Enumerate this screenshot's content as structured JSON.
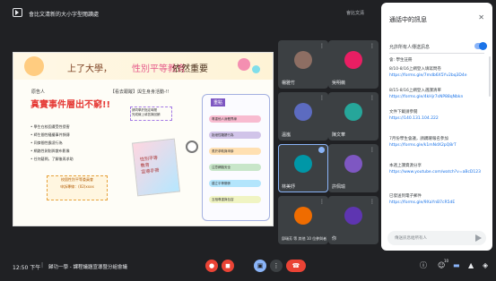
{
  "window": {
    "title": "會比文清新的大小字型閱讀處",
    "badge": "會比文清"
  },
  "slide": {
    "title_a": "上了大學，",
    "title_b": "性別平等教育",
    "title_c": "依然重要",
    "left_small": "原告人",
    "left_big": "真實事件層出不窮!!",
    "left_list": [
      "• 學生在校園遭受性侵害",
      "• 師生間性騷擾事件頻傳",
      "• 同儕間性霸凌行為",
      "• 網路性剝削與散布影像",
      "• 任何疑問，了解後再求助"
    ],
    "left_box": [
      "校園性別平等委員會",
      "申訴專線：(02)xxxx"
    ],
    "mid_head": "【看去跟蹤】與生身身活動-!!",
    "mid_box": [
      "請同學於指定時間",
      "完成線上填答與回饋"
    ],
    "book_text": [
      "性別平等",
      "教育",
      "宣導手冊"
    ],
    "mind_title": "重點",
    "mind_items": [
      "尊重他人身體界線",
      "拒絕性騷擾行為",
      "勇於求助與申訴",
      "注意網路安全",
      "建立平等關係",
      "互相尊重與包容"
    ]
  },
  "participants": [
    {
      "name": "楊雅竹",
      "color": "#8d6e63"
    },
    {
      "name": "吳明薇",
      "color": "#e91e63"
    },
    {
      "name": "溫嵐",
      "color": "#5c6bc0"
    },
    {
      "name": "陳文華",
      "color": "#26a69a"
    },
    {
      "name": "林美妤",
      "color": "#0097a7"
    },
    {
      "name": "許佩瑜",
      "color": "#7e57c2"
    },
    {
      "name": "邱瑞芳 等 其他 10 位參與者",
      "color": "#ef6c00"
    },
    {
      "name": "你",
      "color": "#5e35b1"
    }
  ],
  "chat": {
    "title": "通話中的訊息",
    "close": "✕",
    "setting_label": "允許所有人傳送訊息",
    "messages": [
      {
        "text": "會: 學生註冊",
        "link": ""
      },
      {
        "text": "8/10-8/16上網登入填寫問卷",
        "link": "https://forms.gle/7mdb6X5Yv2bq3D4e"
      },
      {
        "text": "8/15-8/16上網登入選課清單",
        "link": "https://forms.gle/4kHjr7sNP88qNbkn"
      },
      {
        "text": "文件下載請參閱",
        "link": "https://140.131.104.222"
      },
      {
        "text": "7月份學生會議，請踴躍報名參加",
        "link": "https://forms.gle/k1mNdX2pQ8rT"
      },
      {
        "text": "本週上課資源分享",
        "link": "https://www.youtube.com/watch?v=aBcD123"
      },
      {
        "text": "已發送到電子郵件",
        "link": "https://forms.gle/9XaYnB7cR5dE"
      }
    ],
    "input_placeholder": "傳送訊息給所有人"
  },
  "bottom": {
    "time": "12:50 下午",
    "separator": "|",
    "meeting": "歸功一學 - 課程議題宣導暨分組會議",
    "controls": [
      {
        "name": "mic-off-button",
        "glyph": "●",
        "color": "#ea4335"
      },
      {
        "name": "camera-off-button",
        "glyph": "◼",
        "color": "#ea4335"
      },
      {
        "name": "present-button",
        "glyph": "▣",
        "color": "#8ab4f8"
      },
      {
        "name": "more-options-button",
        "glyph": "⋮",
        "color": "#3c4043"
      },
      {
        "name": "leave-call-button",
        "glyph": "☎",
        "color": "#ea4335"
      }
    ],
    "right_icons": [
      {
        "name": "info-icon",
        "glyph": "ⓘ"
      },
      {
        "name": "people-icon",
        "glyph": "☺"
      },
      {
        "name": "chat-icon",
        "glyph": "▬"
      },
      {
        "name": "activities-icon",
        "glyph": "▲"
      },
      {
        "name": "host-controls-icon",
        "glyph": "◈"
      }
    ],
    "people_count": "10"
  }
}
